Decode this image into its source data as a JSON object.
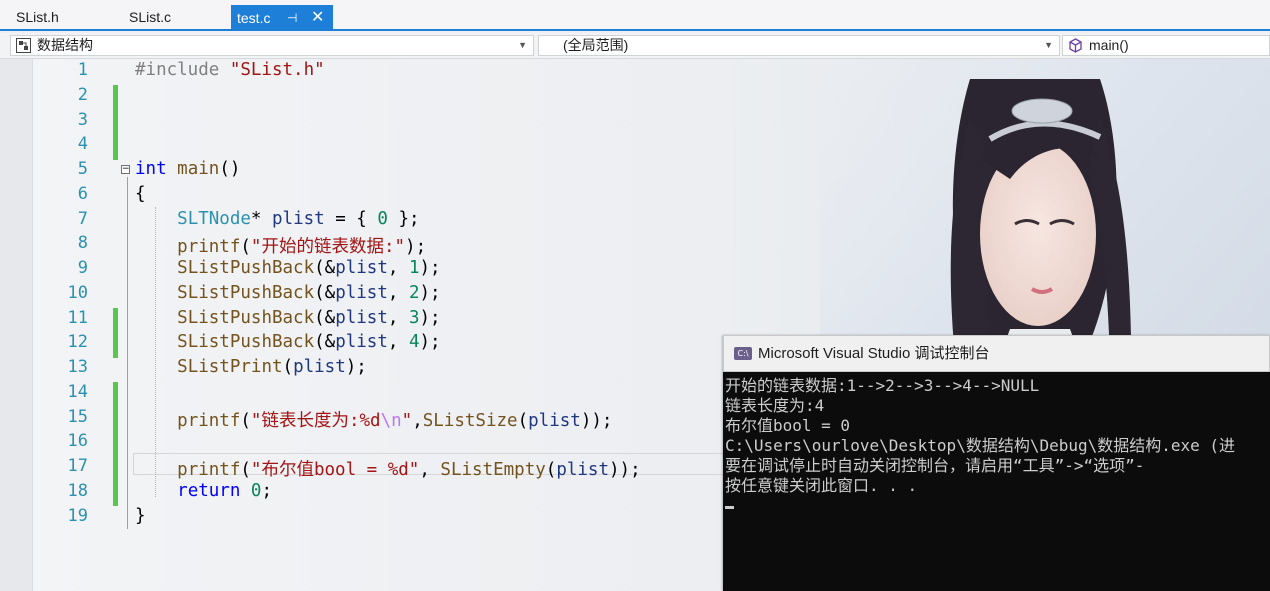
{
  "tabs": [
    {
      "label": "SList.h"
    },
    {
      "label": "SList.c"
    },
    {
      "label": "test.c",
      "active": true
    }
  ],
  "navbar": {
    "project": "数据结构",
    "scope": "(全局范围)",
    "member": "main()"
  },
  "editor": {
    "line_numbers": [
      "1",
      "2",
      "3",
      "4",
      "5",
      "6",
      "7",
      "8",
      "9",
      "10",
      "11",
      "12",
      "13",
      "14",
      "15",
      "16",
      "17",
      "18",
      "19"
    ],
    "lines": [
      [
        {
          "t": "#include ",
          "c": "pp"
        },
        {
          "t": "\"SList.h\"",
          "c": "str"
        }
      ],
      [],
      [],
      [],
      [
        {
          "t": "int",
          "c": "kw"
        },
        {
          "t": " "
        },
        {
          "t": "main",
          "c": "fn"
        },
        {
          "t": "()"
        }
      ],
      [
        {
          "t": "{"
        }
      ],
      [
        {
          "t": "    "
        },
        {
          "t": "SLTNode",
          "c": "ty"
        },
        {
          "t": "* "
        },
        {
          "t": "plist",
          "c": "var"
        },
        {
          "t": " = { "
        },
        {
          "t": "0",
          "c": "num"
        },
        {
          "t": " };"
        }
      ],
      [
        {
          "t": "    "
        },
        {
          "t": "printf",
          "c": "fn"
        },
        {
          "t": "("
        },
        {
          "t": "\"开始的链表数据:\"",
          "c": "str"
        },
        {
          "t": ");"
        }
      ],
      [
        {
          "t": "    "
        },
        {
          "t": "SListPushBack",
          "c": "fn"
        },
        {
          "t": "(&"
        },
        {
          "t": "plist",
          "c": "var"
        },
        {
          "t": ", "
        },
        {
          "t": "1",
          "c": "num"
        },
        {
          "t": ");"
        }
      ],
      [
        {
          "t": "    "
        },
        {
          "t": "SListPushBack",
          "c": "fn"
        },
        {
          "t": "(&"
        },
        {
          "t": "plist",
          "c": "var"
        },
        {
          "t": ", "
        },
        {
          "t": "2",
          "c": "num"
        },
        {
          "t": ");"
        }
      ],
      [
        {
          "t": "    "
        },
        {
          "t": "SListPushBack",
          "c": "fn"
        },
        {
          "t": "(&"
        },
        {
          "t": "plist",
          "c": "var"
        },
        {
          "t": ", "
        },
        {
          "t": "3",
          "c": "num"
        },
        {
          "t": ");"
        }
      ],
      [
        {
          "t": "    "
        },
        {
          "t": "SListPushBack",
          "c": "fn"
        },
        {
          "t": "(&"
        },
        {
          "t": "plist",
          "c": "var"
        },
        {
          "t": ", "
        },
        {
          "t": "4",
          "c": "num"
        },
        {
          "t": ");"
        }
      ],
      [
        {
          "t": "    "
        },
        {
          "t": "SListPrint",
          "c": "fn"
        },
        {
          "t": "("
        },
        {
          "t": "plist",
          "c": "var"
        },
        {
          "t": ");"
        }
      ],
      [],
      [
        {
          "t": "    "
        },
        {
          "t": "printf",
          "c": "fn"
        },
        {
          "t": "("
        },
        {
          "t": "\"链表长度为:%d",
          "c": "str"
        },
        {
          "t": "\\n",
          "c": "esc"
        },
        {
          "t": "\"",
          "c": "str"
        },
        {
          "t": ","
        },
        {
          "t": "SListSize",
          "c": "fn"
        },
        {
          "t": "("
        },
        {
          "t": "plist",
          "c": "var"
        },
        {
          "t": "));"
        }
      ],
      [],
      [
        {
          "t": "    "
        },
        {
          "t": "printf",
          "c": "fn"
        },
        {
          "t": "("
        },
        {
          "t": "\"布尔值bool = %d\"",
          "c": "str"
        },
        {
          "t": ", "
        },
        {
          "t": "SListEmpty",
          "c": "fn"
        },
        {
          "t": "("
        },
        {
          "t": "plist",
          "c": "var"
        },
        {
          "t": "));"
        }
      ],
      [
        {
          "t": "    "
        },
        {
          "t": "return",
          "c": "kw"
        },
        {
          "t": " "
        },
        {
          "t": "0",
          "c": "num"
        },
        {
          "t": ";"
        }
      ],
      [
        {
          "t": "}"
        }
      ]
    ],
    "changed_lines": [
      2,
      3,
      4,
      11,
      12,
      14,
      15,
      16,
      17,
      18
    ]
  },
  "console": {
    "title": "Microsoft Visual Studio 调试控制台",
    "lines": [
      "开始的链表数据:1-->2-->3-->4-->NULL",
      "链表长度为:4",
      "布尔值bool = 0",
      "C:\\Users\\ourlove\\Desktop\\数据结构\\Debug\\数据结构.exe (进",
      "要在调试停止时自动关闭控制台，请启用“工具”->“选项”-",
      "按任意键关闭此窗口. . ."
    ]
  },
  "colors": {
    "accent": "#1e7fd8",
    "change_bar": "#57c84d",
    "line_number": "#2b91af"
  }
}
